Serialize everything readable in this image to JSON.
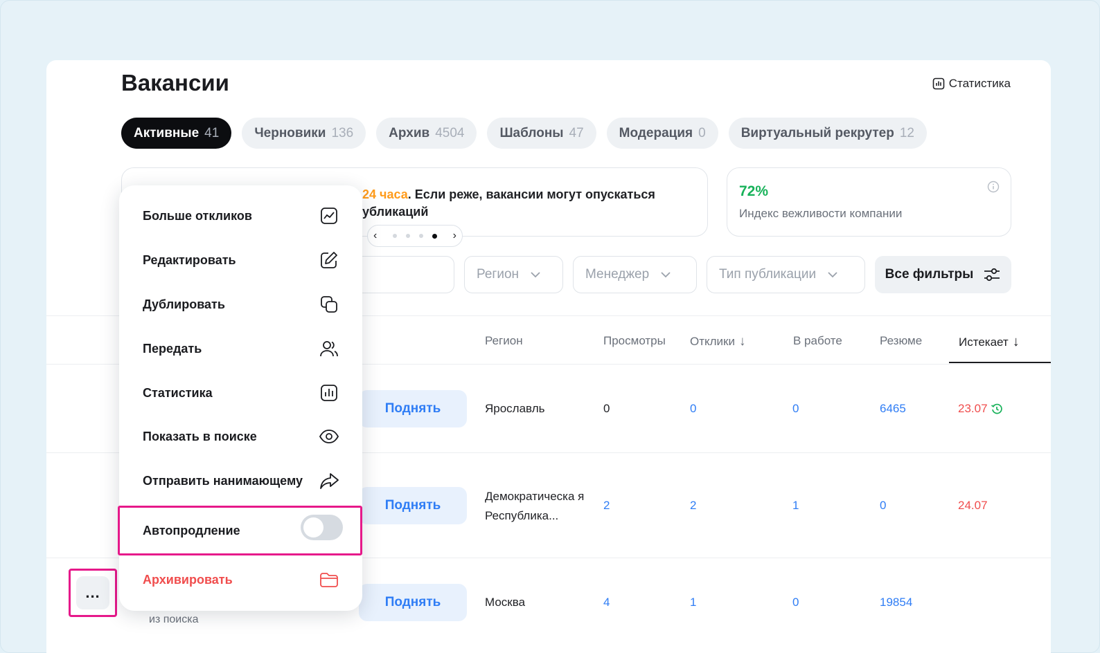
{
  "header": {
    "title": "Вакансии",
    "stats_label": "Статистика"
  },
  "tabs": [
    {
      "label": "Активные",
      "count": "41"
    },
    {
      "label": "Черновики",
      "count": "136"
    },
    {
      "label": "Архив",
      "count": "4504"
    },
    {
      "label": "Шаблоны",
      "count": "47"
    },
    {
      "label": "Модерация",
      "count": "0"
    },
    {
      "label": "Виртуальный рекрутер",
      "count": "12"
    }
  ],
  "banner": {
    "highlight": "24 часа",
    "line1_rest": ". Если реже, вакансии могут опускаться",
    "line2": "убликаций"
  },
  "politeness": {
    "value": "72%",
    "label": "Индекс вежливости компании"
  },
  "filters": {
    "region": "Регион",
    "manager": "Менеджер",
    "publication_type": "Тип публикации",
    "all_filters": "Все фильтры"
  },
  "table": {
    "columns": {
      "region": "Регион",
      "views": "Просмотры",
      "responses": "Отклики",
      "in_work": "В работе",
      "resumes": "Резюме",
      "expires": "Истекает"
    },
    "lift_label": "Поднять",
    "rows": [
      {
        "region": "Ярославль",
        "views": "0",
        "responses": "0",
        "in_work": "0",
        "resumes": "6465",
        "expires": "23.07"
      },
      {
        "region": "Демократическа я Республика...",
        "views": "2",
        "responses": "2",
        "in_work": "1",
        "resumes": "0",
        "expires": "24.07"
      },
      {
        "region": "Москва",
        "views": "4",
        "responses": "1",
        "in_work": "0",
        "resumes": "19854",
        "expires": ""
      }
    ],
    "row3_note": "из поиска"
  },
  "more_button": "...",
  "menu": {
    "items": [
      {
        "label": "Больше откликов",
        "icon": "trend-chart-icon"
      },
      {
        "label": "Редактировать",
        "icon": "edit-icon"
      },
      {
        "label": "Дублировать",
        "icon": "duplicate-icon"
      },
      {
        "label": "Передать",
        "icon": "users-icon"
      },
      {
        "label": "Статистика",
        "icon": "stats-icon"
      },
      {
        "label": "Показать в поиске",
        "icon": "eye-icon"
      },
      {
        "label": "Отправить нанимающему",
        "icon": "share-icon"
      }
    ],
    "autorenew_label": "Автопродление",
    "autorenew_on": false,
    "archive_label": "Архивировать"
  },
  "colors": {
    "accent_blue": "#2f7df5",
    "danger_red": "#f04d4d",
    "success_green": "#18b25a",
    "warning_orange": "#ff9b1a",
    "highlight_magenta": "#e6198a"
  }
}
